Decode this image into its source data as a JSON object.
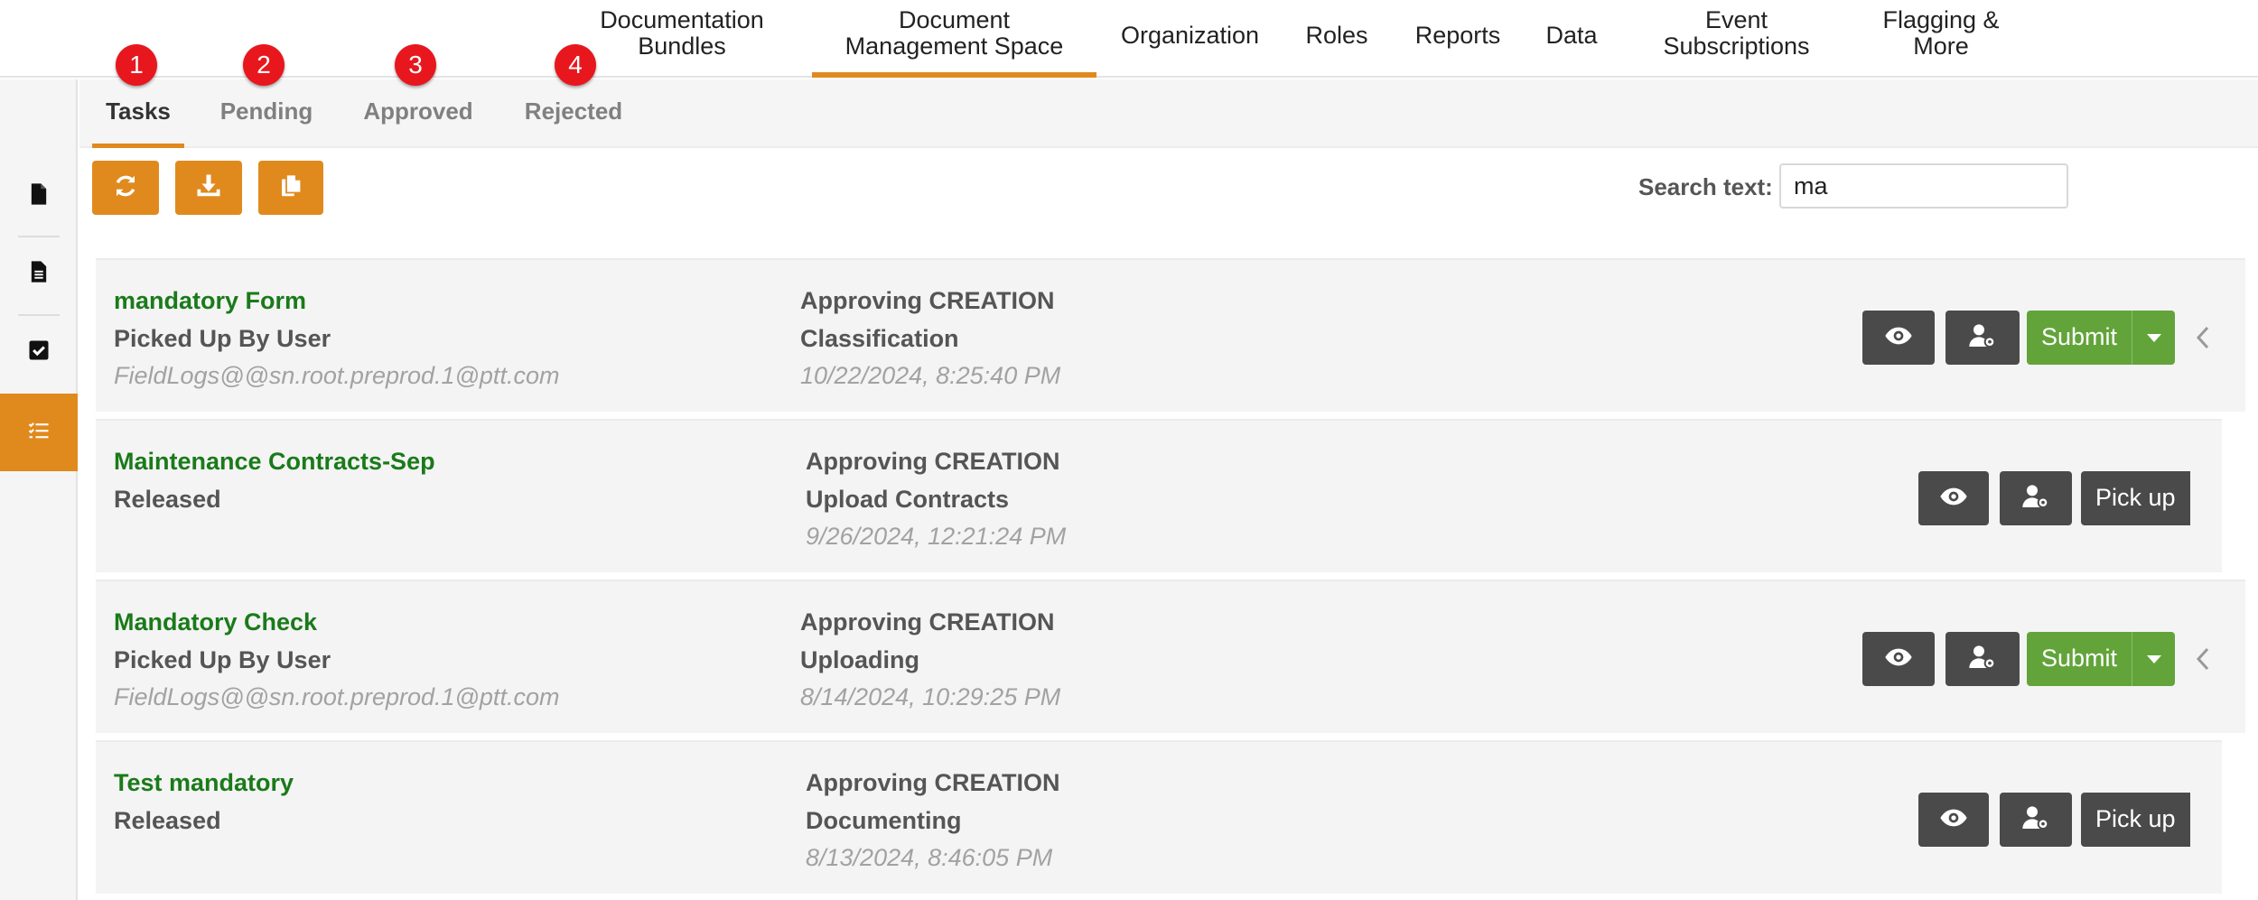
{
  "topnav": {
    "items": [
      {
        "label": "Documentation Bundles",
        "line1": "Documentation",
        "line2": "Bundles",
        "active": false
      },
      {
        "label": "Document Management Space",
        "line1": "Document",
        "line2": "Management Space",
        "active": true
      },
      {
        "label": "Organization",
        "active": false
      },
      {
        "label": "Roles",
        "active": false
      },
      {
        "label": "Reports",
        "active": false
      },
      {
        "label": "Data",
        "active": false
      },
      {
        "label": "Event Subscriptions",
        "line1": "Event",
        "line2": "Subscriptions",
        "active": false
      },
      {
        "label": "Flagging & More",
        "line1": "Flagging &",
        "line2": "More",
        "active": false
      }
    ]
  },
  "sidebar": {
    "items": [
      {
        "icon": "document-icon",
        "active": false
      },
      {
        "icon": "document-lines-icon",
        "active": false
      },
      {
        "icon": "checkbox-icon",
        "active": false
      },
      {
        "icon": "task-list-icon",
        "active": true
      }
    ]
  },
  "tabs": [
    {
      "label": "Tasks",
      "badge": "1",
      "active": true
    },
    {
      "label": "Pending",
      "badge": "2",
      "active": false
    },
    {
      "label": "Approved",
      "badge": "3",
      "active": false
    },
    {
      "label": "Rejected",
      "badge": "4",
      "active": false
    }
  ],
  "toolbar": {
    "buttons": [
      {
        "icon": "refresh-icon"
      },
      {
        "icon": "download-icon"
      },
      {
        "icon": "copy-icon"
      }
    ]
  },
  "search": {
    "label": "Search text:",
    "value": "ma"
  },
  "tasks": [
    {
      "title": "mandatory Form",
      "status": "Picked Up By User",
      "user": "FieldLogs@@sn.root.preprod.1@ptt.com",
      "approving": "Approving CREATION",
      "stage": "Classification",
      "date": "10/22/2024, 8:25:40 PM",
      "action": "Submit"
    },
    {
      "title": "Maintenance Contracts-Sep",
      "status": "Released",
      "user": "",
      "approving": "Approving CREATION",
      "stage": "Upload Contracts",
      "date": "9/26/2024, 12:21:24 PM",
      "action": "Pick up"
    },
    {
      "title": "Mandatory Check",
      "status": "Picked Up By User",
      "user": "FieldLogs@@sn.root.preprod.1@ptt.com",
      "approving": "Approving CREATION",
      "stage": "Uploading",
      "date": "8/14/2024, 10:29:25 PM",
      "action": "Submit"
    },
    {
      "title": "Test mandatory",
      "status": "Released",
      "user": "",
      "approving": "Approving CREATION",
      "stage": "Documenting",
      "date": "8/13/2024, 8:46:05 PM",
      "action": "Pick up"
    }
  ],
  "colors": {
    "accent": "#e08a1e",
    "title_green": "#1a7a1a",
    "submit_green": "#62a43a",
    "dark_button": "#4a4a4a",
    "badge_red": "#e8171e"
  }
}
